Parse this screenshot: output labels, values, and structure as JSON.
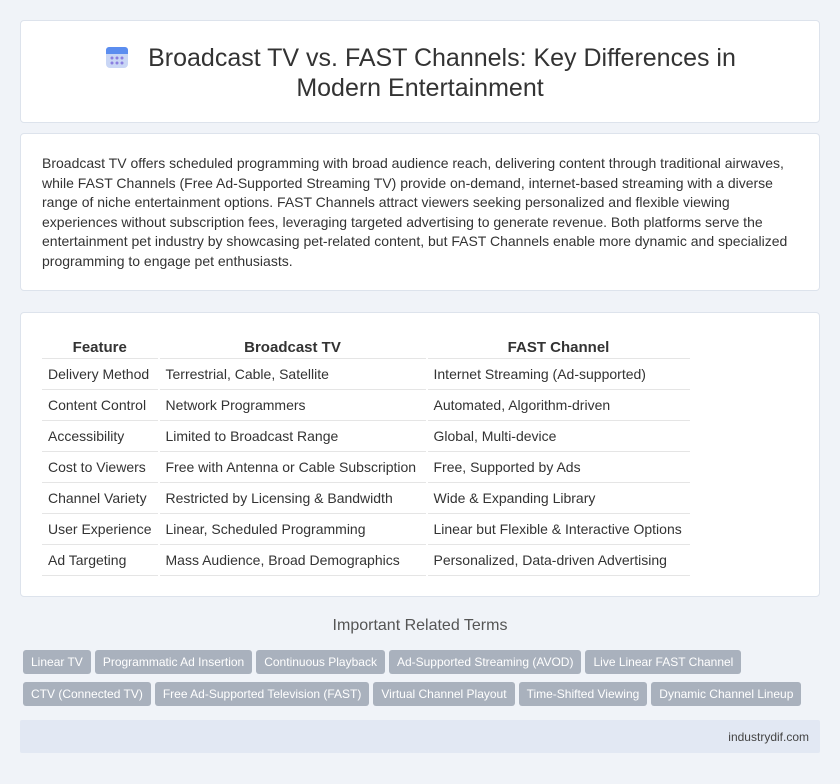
{
  "header": {
    "title": "Broadcast TV vs. FAST Channels: Key Differences in Modern Entertainment",
    "icon": "calendar-icon"
  },
  "intro": {
    "text": "Broadcast TV offers scheduled programming with broad audience reach, delivering content through traditional airwaves, while FAST Channels (Free Ad-Supported Streaming TV) provide on-demand, internet-based streaming with a diverse range of niche entertainment options. FAST Channels attract viewers seeking personalized and flexible viewing experiences without subscription fees, leveraging targeted advertising to generate revenue. Both platforms serve the entertainment pet industry by showcasing pet-related content, but FAST Channels enable more dynamic and specialized programming to engage pet enthusiasts."
  },
  "table": {
    "headers": [
      "Feature",
      "Broadcast TV",
      "FAST Channel"
    ],
    "rows": [
      [
        "Delivery Method",
        "Terrestrial, Cable, Satellite",
        "Internet Streaming (Ad-supported)"
      ],
      [
        "Content Control",
        "Network Programmers",
        "Automated, Algorithm-driven"
      ],
      [
        "Accessibility",
        "Limited to Broadcast Range",
        "Global, Multi-device"
      ],
      [
        "Cost to Viewers",
        "Free with Antenna or Cable Subscription",
        "Free, Supported by Ads"
      ],
      [
        "Channel Variety",
        "Restricted by Licensing & Bandwidth",
        "Wide & Expanding Library"
      ],
      [
        "User Experience",
        "Linear, Scheduled Programming",
        "Linear but Flexible & Interactive Options"
      ],
      [
        "Ad Targeting",
        "Mass Audience, Broad Demographics",
        "Personalized, Data-driven Advertising"
      ]
    ]
  },
  "related": {
    "title": "Important Related Terms",
    "tags": [
      "Linear TV",
      "Programmatic Ad Insertion",
      "Continuous Playback",
      "Ad-Supported Streaming (AVOD)",
      "Live Linear FAST Channel",
      "CTV (Connected TV)",
      "Free Ad-Supported Television (FAST)",
      "Virtual Channel Playout",
      "Time-Shifted Viewing",
      "Dynamic Channel Lineup"
    ]
  },
  "footer": {
    "site": "industrydif.com"
  },
  "colors": {
    "background": "#f0f3f8",
    "tag": "#a9b1bd",
    "footer": "#e2e8f3",
    "icon_top": "#5b8def",
    "icon_body": "#c9d6f5"
  }
}
